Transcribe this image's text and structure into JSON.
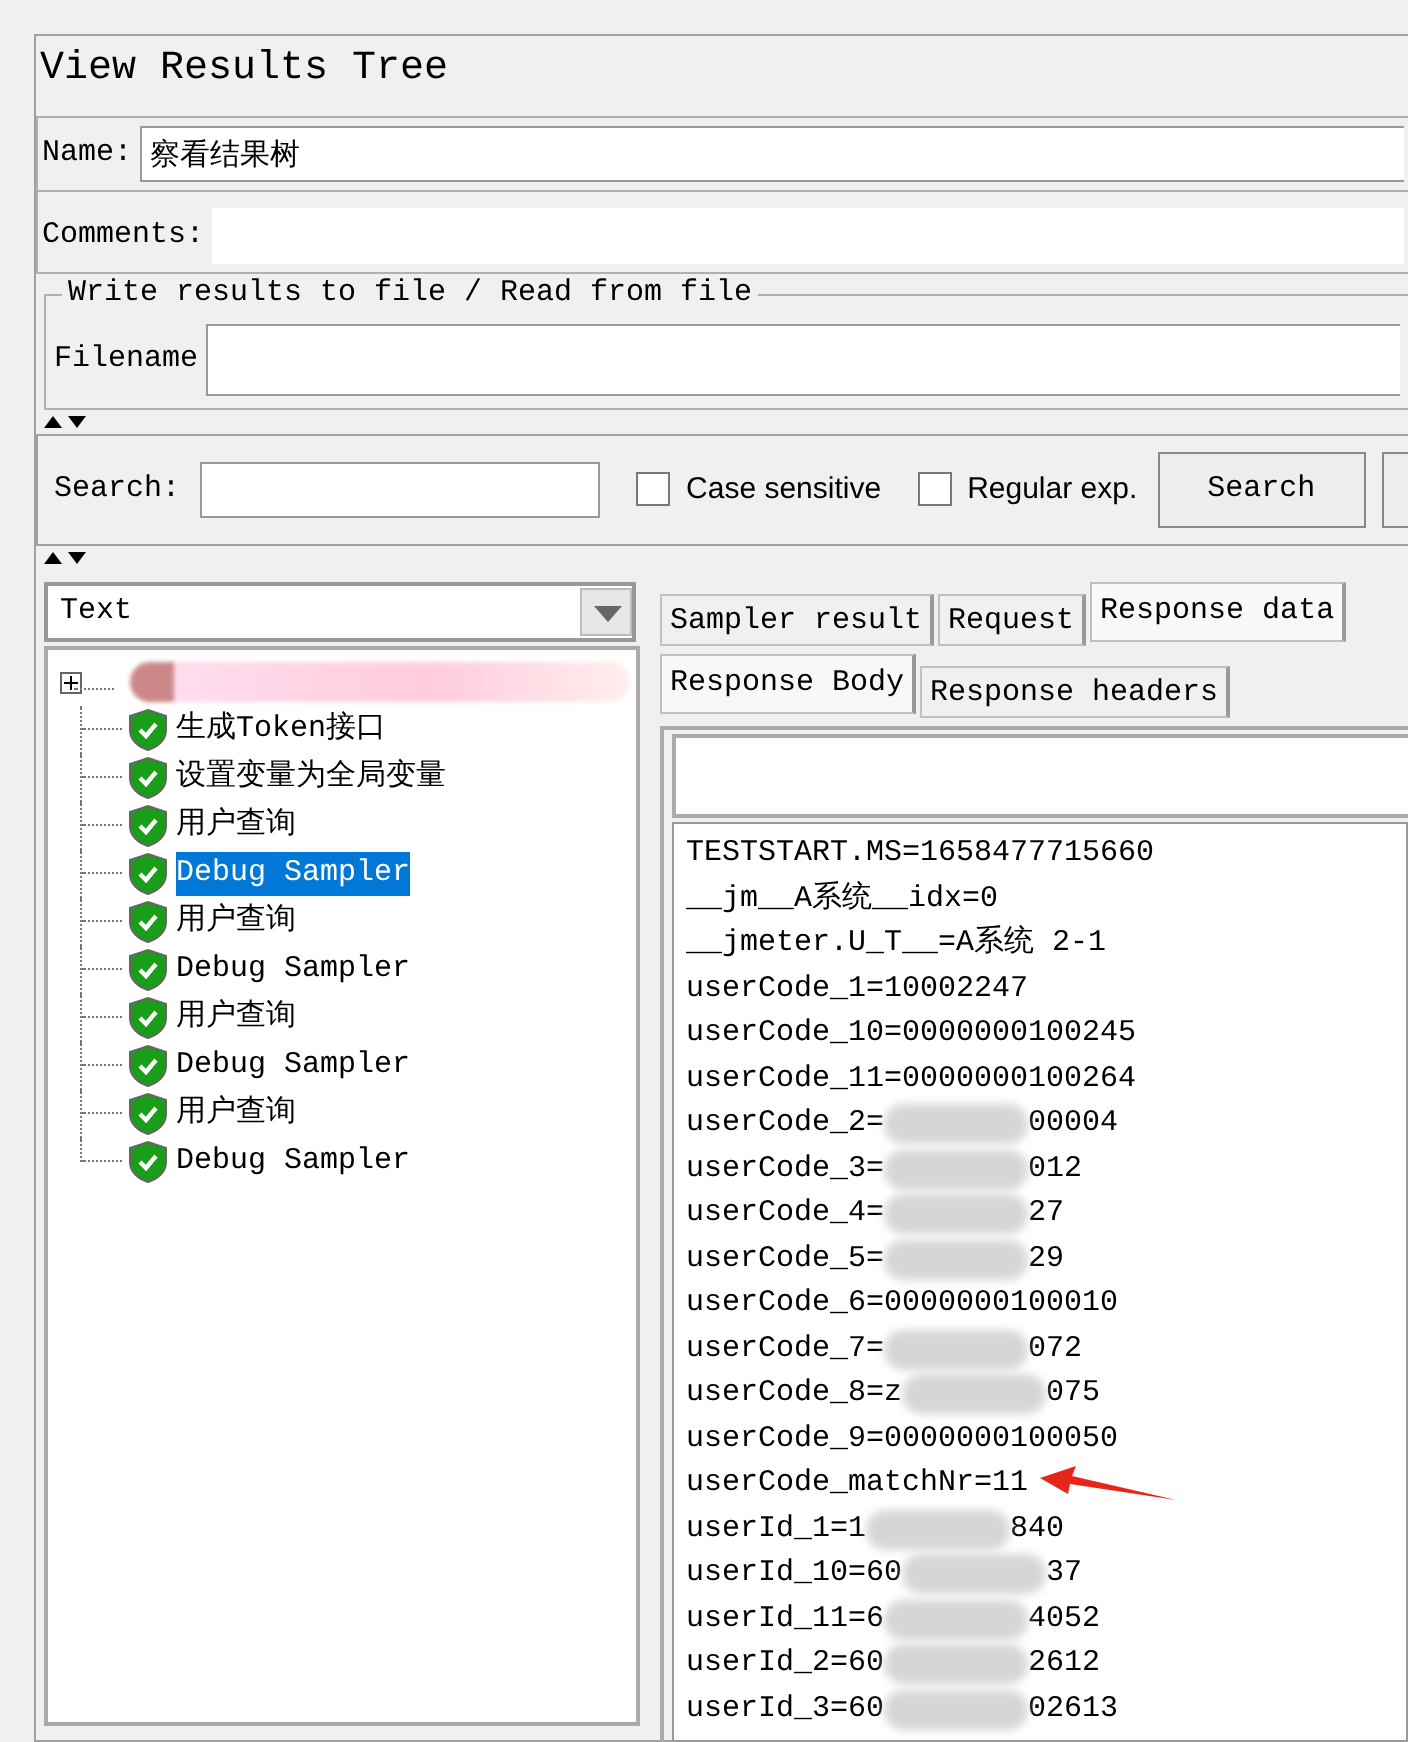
{
  "title": "View Results Tree",
  "name_field": {
    "label": "Name:",
    "value": "察看结果树"
  },
  "comments_field": {
    "label": "Comments:"
  },
  "file_group": {
    "legend": "Write results to file / Read from file",
    "filename_label": "Filename"
  },
  "search_bar": {
    "label": "Search:",
    "options": [
      {
        "label": "Case sensitive",
        "checked": false
      },
      {
        "label": "Regular exp.",
        "checked": false
      }
    ],
    "button": "Search"
  },
  "renderer": {
    "value": "Text"
  },
  "tree": [
    {
      "kind": "redacted",
      "expanded": false
    },
    {
      "kind": "sample",
      "label": "生成Token接口",
      "selected": false
    },
    {
      "kind": "sample",
      "label": "设置变量为全局变量",
      "selected": false
    },
    {
      "kind": "sample",
      "label": "用户查询",
      "selected": false
    },
    {
      "kind": "sample",
      "label": "Debug Sampler",
      "selected": true
    },
    {
      "kind": "sample",
      "label": "用户查询",
      "selected": false
    },
    {
      "kind": "sample",
      "label": "Debug Sampler",
      "selected": false
    },
    {
      "kind": "sample",
      "label": "用户查询",
      "selected": false
    },
    {
      "kind": "sample",
      "label": "Debug Sampler",
      "selected": false
    },
    {
      "kind": "sample",
      "label": "用户查询",
      "selected": false
    },
    {
      "kind": "sample",
      "label": "Debug Sampler",
      "selected": false
    }
  ],
  "tabs": [
    {
      "label": "Sampler result",
      "selected": false
    },
    {
      "label": "Request",
      "selected": false
    },
    {
      "label": "Response data",
      "selected": true
    }
  ],
  "subtabs": [
    {
      "label": "Response Body",
      "selected": true
    },
    {
      "label": "Response headers",
      "selected": false
    }
  ],
  "response_lines": [
    {
      "text": "TESTSTART.MS=1658477715660"
    },
    {
      "text": "__jm__A系统__idx=0"
    },
    {
      "text": "__jmeter.U_T__=A系统 2-1"
    },
    {
      "text": "userCode_1=10002247"
    },
    {
      "text": "userCode_10=0000000100245"
    },
    {
      "text": "userCode_11=0000000100264"
    },
    {
      "text": "userCode_2=",
      "redacted": true,
      "tail": "00004"
    },
    {
      "text": "userCode_3=",
      "redacted": true,
      "tail": "012"
    },
    {
      "text": "userCode_4=",
      "redacted": true,
      "tail": "27"
    },
    {
      "text": "userCode_5=",
      "redacted": true,
      "tail": "29"
    },
    {
      "text": "userCode_6=0000000100010"
    },
    {
      "text": "userCode_7=",
      "redacted": true,
      "tail": "072"
    },
    {
      "text": "userCode_8=z",
      "redacted": true,
      "tail": "075"
    },
    {
      "text": "userCode_9=0000000100050"
    },
    {
      "text": "userCode_matchNr=11",
      "pointer": true
    },
    {
      "text": "userId_1=1",
      "redacted": true,
      "tail": "840"
    },
    {
      "text": "userId_10=60",
      "redacted": true,
      "tail": "37"
    },
    {
      "text": "userId_11=6",
      "redacted": true,
      "tail": "4052"
    },
    {
      "text": "userId_2=60",
      "redacted": true,
      "tail": "2612"
    },
    {
      "text": "userId_3=60",
      "redacted": true,
      "tail": "02613"
    }
  ]
}
